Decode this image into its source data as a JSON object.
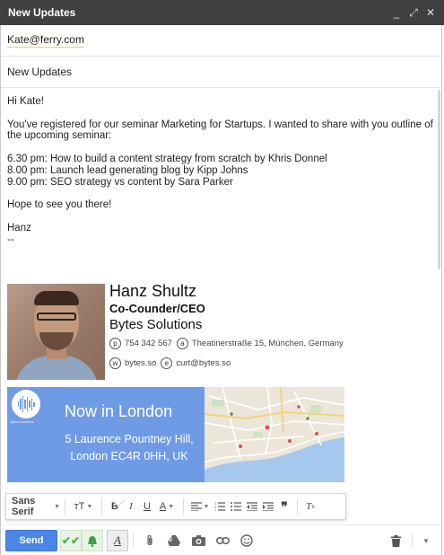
{
  "window": {
    "title": "New Updates",
    "controls": {
      "minimize": "_",
      "popout": "⤢",
      "close": "✕"
    }
  },
  "compose": {
    "to": "Kate@ferry.com",
    "subject": "New Updates"
  },
  "body": {
    "greeting": "Hi Kate!",
    "intro": "You've registered for our seminar  Marketing for Startups. I  wanted to share with you outline of the upcoming seminar:",
    "agenda": [
      "6.30 pm: How to build a content strategy from scratch by Khris Donnel",
      "8.00 pm: Launch lead generating blog by Kipp Johns",
      "9.00 pm: SEO strategy vs content by Sara Parker"
    ],
    "closing": "Hope to see you there!",
    "sign": "Hanz",
    "dashes": "--"
  },
  "signature": {
    "name": "Hanz Shultz",
    "role": "Co-Counder/CEO",
    "company": "Bytes Solutions",
    "phone_letter": "p",
    "phone": "754 342 567",
    "address_letter": "a",
    "address": "Theatinerstraße 15, München, Germany",
    "website_letter": "w",
    "website": "bytes.so",
    "email_letter": "e",
    "email": "curt@bytes.so"
  },
  "banner": {
    "logo_label": "bytes solutions",
    "title": "Now in London",
    "address": "5 Laurence Pountney Hill, London EC4R 0HH, UK",
    "brand_color": "#6f9be6"
  },
  "format_bar": {
    "font": "Sans Serif",
    "size_icon": "тT",
    "bold": "B",
    "italic": "I",
    "underline": "U",
    "text_color": "A",
    "align_icon": "align-icon",
    "numbered_icon": "numbered-list-icon",
    "bullet_icon": "bulleted-list-icon",
    "outdent_icon": "outdent-icon",
    "indent_icon": "indent-icon",
    "quote_icon": "quote-icon",
    "clear_icon": "clear-formatting-icon"
  },
  "bottom_bar": {
    "send_label": "Send",
    "colors": {
      "send": "#4a86e8",
      "ext_green": "#e9f3e5"
    }
  }
}
